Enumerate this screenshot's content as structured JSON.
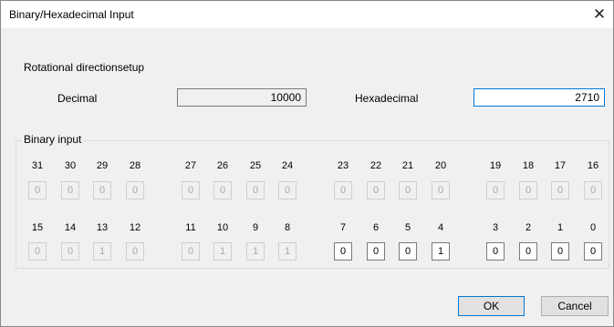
{
  "window": {
    "title": "Binary/Hexadecimal Input",
    "close_glyph": "✕"
  },
  "section_label": "Rotational directionsetup",
  "decimal": {
    "label": "Decimal",
    "value": "10000"
  },
  "hexadecimal": {
    "label": "Hexadecimal",
    "value": "2710"
  },
  "binary_group": {
    "label": "Binary input",
    "rows": [
      [
        {
          "bit": "31",
          "value": "0",
          "enabled": false
        },
        {
          "bit": "30",
          "value": "0",
          "enabled": false
        },
        {
          "bit": "29",
          "value": "0",
          "enabled": false
        },
        {
          "bit": "28",
          "value": "0",
          "enabled": false
        },
        {
          "bit": "27",
          "value": "0",
          "enabled": false
        },
        {
          "bit": "26",
          "value": "0",
          "enabled": false
        },
        {
          "bit": "25",
          "value": "0",
          "enabled": false
        },
        {
          "bit": "24",
          "value": "0",
          "enabled": false
        },
        {
          "bit": "23",
          "value": "0",
          "enabled": false
        },
        {
          "bit": "22",
          "value": "0",
          "enabled": false
        },
        {
          "bit": "21",
          "value": "0",
          "enabled": false
        },
        {
          "bit": "20",
          "value": "0",
          "enabled": false
        },
        {
          "bit": "19",
          "value": "0",
          "enabled": false
        },
        {
          "bit": "18",
          "value": "0",
          "enabled": false
        },
        {
          "bit": "17",
          "value": "0",
          "enabled": false
        },
        {
          "bit": "16",
          "value": "0",
          "enabled": false
        }
      ],
      [
        {
          "bit": "15",
          "value": "0",
          "enabled": false
        },
        {
          "bit": "14",
          "value": "0",
          "enabled": false
        },
        {
          "bit": "13",
          "value": "1",
          "enabled": false
        },
        {
          "bit": "12",
          "value": "0",
          "enabled": false
        },
        {
          "bit": "11",
          "value": "0",
          "enabled": false
        },
        {
          "bit": "10",
          "value": "1",
          "enabled": false
        },
        {
          "bit": "9",
          "value": "1",
          "enabled": false
        },
        {
          "bit": "8",
          "value": "1",
          "enabled": false
        },
        {
          "bit": "7",
          "value": "0",
          "enabled": true
        },
        {
          "bit": "6",
          "value": "0",
          "enabled": true
        },
        {
          "bit": "5",
          "value": "0",
          "enabled": true
        },
        {
          "bit": "4",
          "value": "1",
          "enabled": true
        },
        {
          "bit": "3",
          "value": "0",
          "enabled": true
        },
        {
          "bit": "2",
          "value": "0",
          "enabled": true
        },
        {
          "bit": "1",
          "value": "0",
          "enabled": true
        },
        {
          "bit": "0",
          "value": "0",
          "enabled": true
        }
      ]
    ]
  },
  "buttons": {
    "ok": "OK",
    "cancel": "Cancel"
  }
}
